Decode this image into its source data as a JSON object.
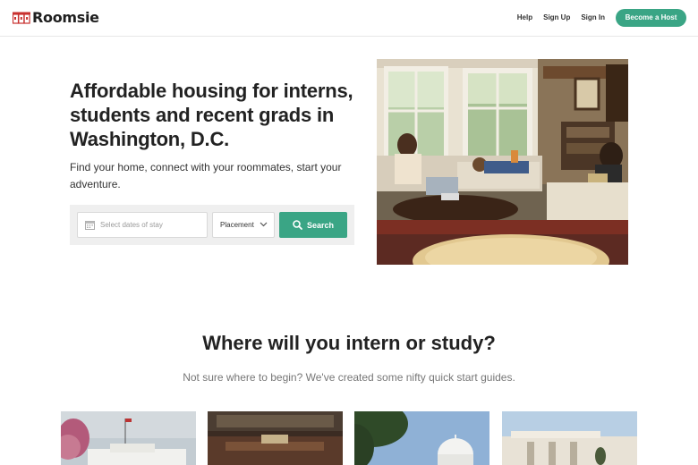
{
  "header": {
    "logo_text": "Roomsie",
    "nav": {
      "help": "Help",
      "sign_up": "Sign Up",
      "sign_in": "Sign In"
    },
    "host_button": "Become a Host"
  },
  "hero": {
    "title": "Affordable housing for interns, students and recent grads in Washington, D.C.",
    "subtitle": "Find your home, connect with your roommates, start your adventure.",
    "search": {
      "date_placeholder": "Select dates of stay",
      "placement_value": "Placement",
      "button_label": "Search"
    }
  },
  "section": {
    "title": "Where will you intern or study?",
    "subtitle": "Not sure where to begin? We've created some nifty quick start guides."
  },
  "colors": {
    "accent": "#3aa585",
    "brand_red": "#c8312f"
  },
  "icons": [
    "roomsie-logo-icon",
    "calendar-icon",
    "chevron-down-icon",
    "search-icon"
  ]
}
